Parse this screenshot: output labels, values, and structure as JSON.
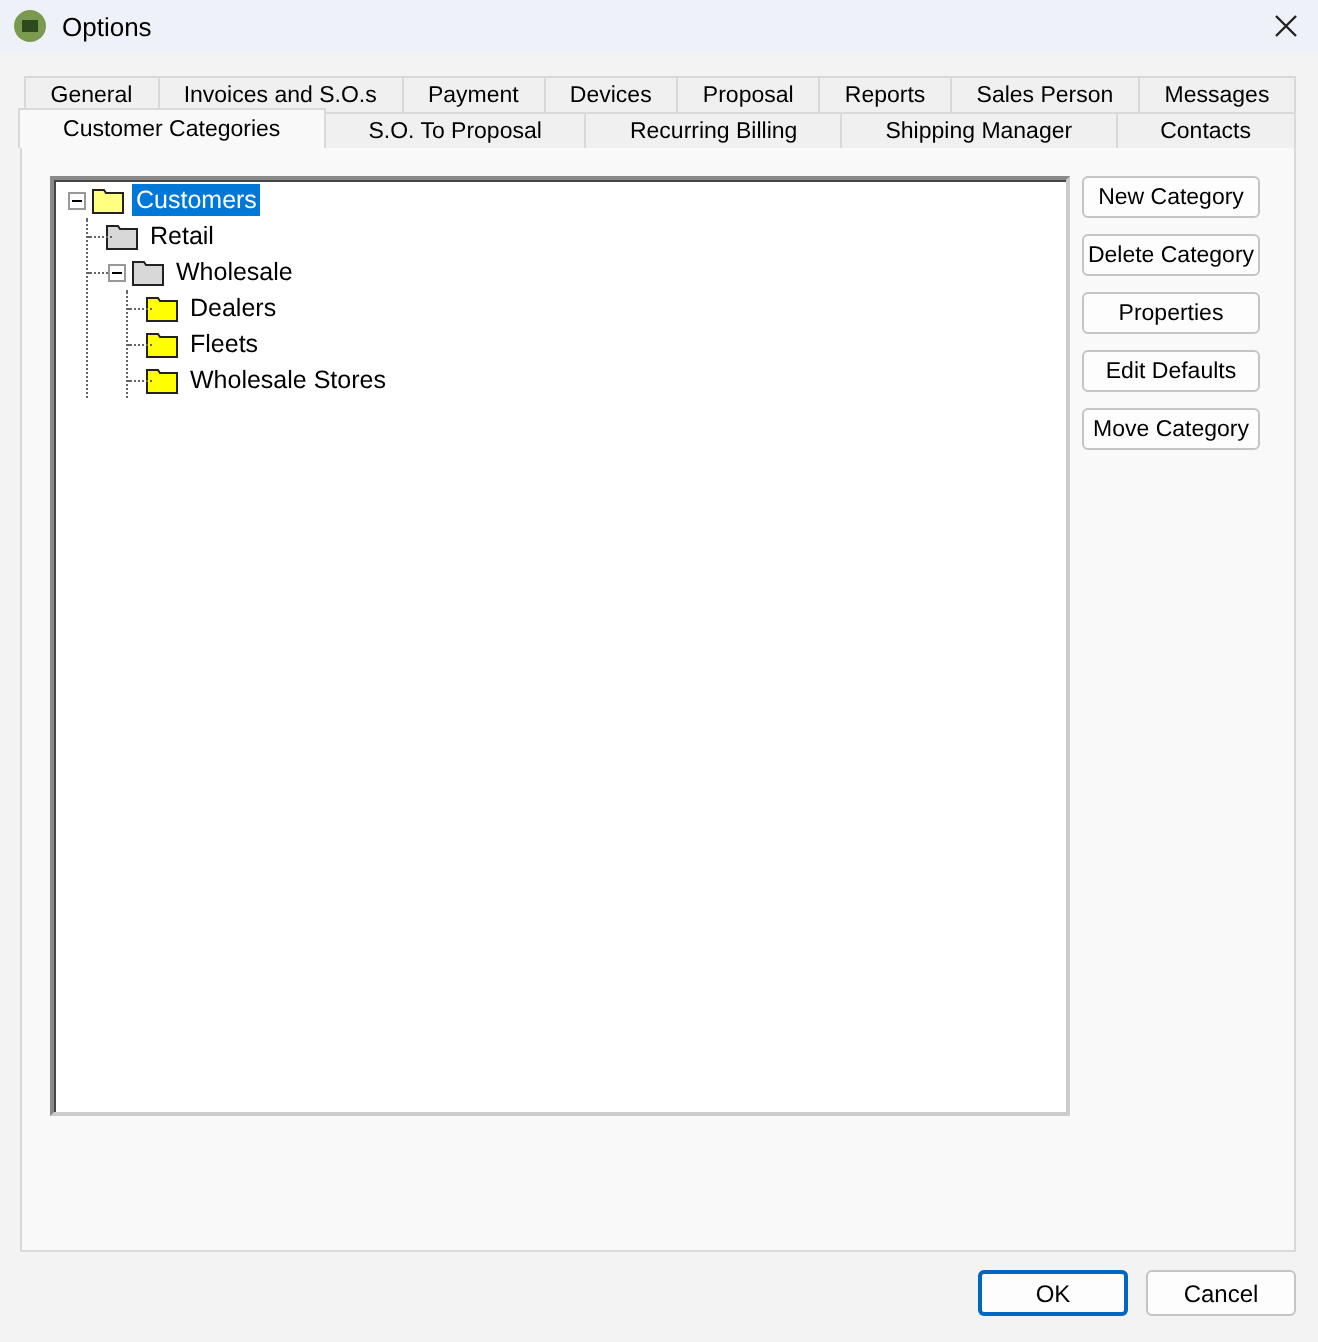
{
  "window": {
    "title": "Options"
  },
  "tab_rows": [
    [
      {
        "label": "General",
        "selected": false
      },
      {
        "label": "Invoices and S.O.s",
        "selected": false
      },
      {
        "label": "Payment",
        "selected": false
      },
      {
        "label": "Devices",
        "selected": false
      },
      {
        "label": "Proposal",
        "selected": false
      },
      {
        "label": "Reports",
        "selected": false
      },
      {
        "label": "Sales Person",
        "selected": false
      },
      {
        "label": "Messages",
        "selected": false
      }
    ],
    [
      {
        "label": "Customer Categories",
        "selected": true
      },
      {
        "label": "S.O. To Proposal",
        "selected": false
      },
      {
        "label": "Recurring Billing",
        "selected": false
      },
      {
        "label": "Shipping Manager",
        "selected": false
      },
      {
        "label": "Contacts",
        "selected": false
      }
    ]
  ],
  "tree": [
    {
      "label": "Customers",
      "selected": true,
      "expanded": true,
      "color": "#ffff80",
      "children": [
        {
          "label": "Retail",
          "selected": false,
          "color": "#d8d8d8"
        },
        {
          "label": "Wholesale",
          "selected": false,
          "expanded": true,
          "color": "#d8d8d8",
          "children": [
            {
              "label": "Dealers",
              "selected": false,
              "color": "#ffff00"
            },
            {
              "label": "Fleets",
              "selected": false,
              "color": "#ffff00"
            },
            {
              "label": "Wholesale Stores",
              "selected": false,
              "color": "#ffff00"
            }
          ]
        }
      ]
    }
  ],
  "side_buttons": [
    "New Category",
    "Delete Category",
    "Properties",
    "Edit Defaults",
    "Move Category"
  ],
  "buttons": [
    "OK",
    "Cancel"
  ]
}
